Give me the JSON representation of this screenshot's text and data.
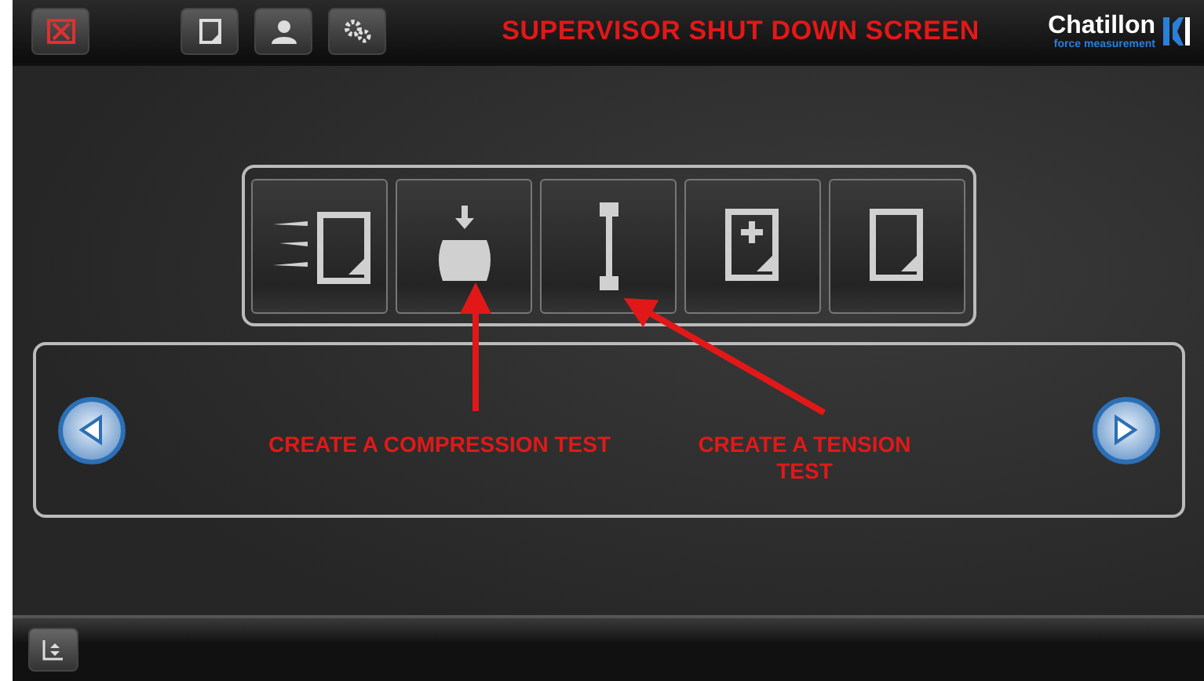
{
  "header": {
    "title": "SUPERVISOR SHUT DOWN SCREEN",
    "logo": {
      "name": "Chatillon",
      "tagline": "force measurement"
    }
  },
  "annotations": [
    {
      "label": "CREATE A COMPRESSION TEST"
    },
    {
      "label": "CREATE A TENSION TEST"
    }
  ]
}
